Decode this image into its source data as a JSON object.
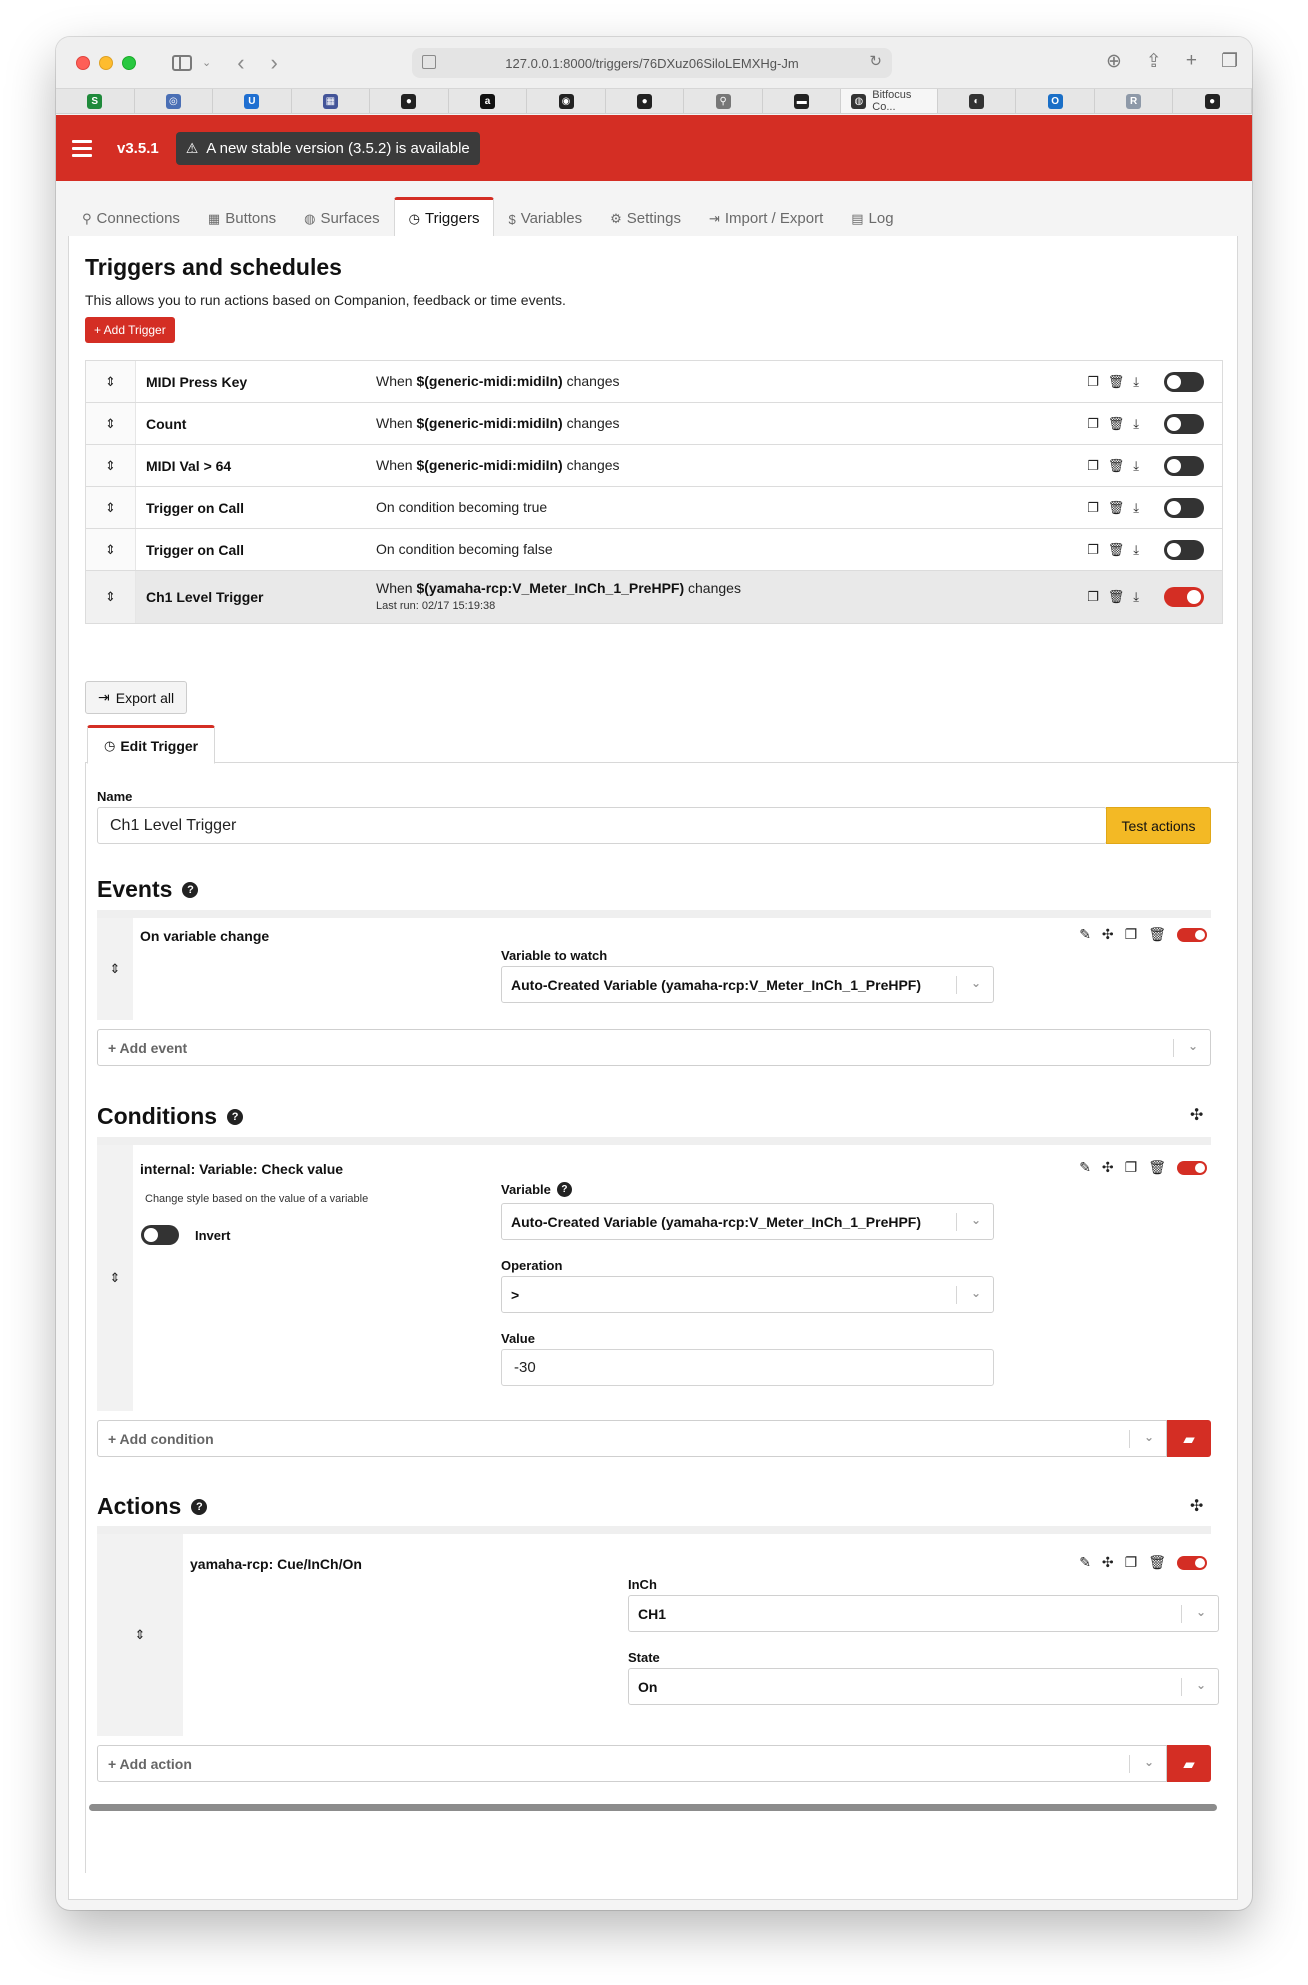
{
  "browser": {
    "url": "127.0.0.1:8000/triggers/76DXuz06SiloLEMXHg-Jm",
    "active_tab_title": "Bitfocus Co...",
    "tab_favicons": [
      {
        "icon": "s-icon",
        "color": "#1f8a3b",
        "glyph": "S"
      },
      {
        "icon": "circle-icon",
        "color": "#4a6fb5",
        "glyph": "◎"
      },
      {
        "icon": "u-icon",
        "color": "#1f6fd1",
        "glyph": "U"
      },
      {
        "icon": "image-icon",
        "color": "#445599",
        "glyph": "▦"
      },
      {
        "icon": "github-icon",
        "color": "#222222",
        "glyph": "●"
      },
      {
        "icon": "amazon-icon",
        "color": "#111111",
        "glyph": "a"
      },
      {
        "icon": "target-icon",
        "color": "#222222",
        "glyph": "◉"
      },
      {
        "icon": "github-icon",
        "color": "#222222",
        "glyph": "●"
      },
      {
        "icon": "wifi-icon",
        "color": "#777777",
        "glyph": "⚲"
      },
      {
        "icon": "terminal-icon",
        "color": "#222222",
        "glyph": "▬"
      },
      {
        "icon": "bitfocus-icon",
        "color": "#333333",
        "glyph": "◍"
      },
      {
        "icon": "globe-icon",
        "color": "#333333",
        "glyph": "◐"
      },
      {
        "icon": "outlook-icon",
        "color": "#1a6fc7",
        "glyph": "O"
      },
      {
        "icon": "r-icon",
        "color": "#8e99a8",
        "glyph": "R"
      },
      {
        "icon": "github-icon",
        "color": "#222222",
        "glyph": "●"
      }
    ]
  },
  "header": {
    "version": "v3.5.1",
    "update_notice": "A new stable version (3.5.2) is available"
  },
  "nav": {
    "tabs": [
      {
        "label": "Connections",
        "icon": "plug-icon",
        "glyph": "⚲"
      },
      {
        "label": "Buttons",
        "icon": "grid-icon",
        "glyph": "▦"
      },
      {
        "label": "Surfaces",
        "icon": "gamepad-icon",
        "glyph": "◍"
      },
      {
        "label": "Triggers",
        "icon": "clock-icon",
        "glyph": "◷"
      },
      {
        "label": "Variables",
        "icon": "dollar-icon",
        "glyph": "$"
      },
      {
        "label": "Settings",
        "icon": "gear-icon",
        "glyph": "⚙"
      },
      {
        "label": "Import / Export",
        "icon": "file-export-icon",
        "glyph": "⇥"
      },
      {
        "label": "Log",
        "icon": "clipboard-icon",
        "glyph": "▤"
      }
    ],
    "active": "Triggers"
  },
  "page": {
    "title": "Triggers and schedules",
    "description": "This allows you to run actions based on Companion, feedback or time events.",
    "add_trigger_label": "+ Add Trigger",
    "export_all_label": "Export all"
  },
  "triggers": [
    {
      "name": "MIDI Press Key",
      "prefix": "When ",
      "variable": "$(generic-midi:midiIn)",
      "suffix": " changes",
      "enabled": false
    },
    {
      "name": "Count",
      "prefix": "When ",
      "variable": "$(generic-midi:midiIn)",
      "suffix": " changes",
      "enabled": false
    },
    {
      "name": "MIDI Val > 64",
      "prefix": "When ",
      "variable": "$(generic-midi:midiIn)",
      "suffix": " changes",
      "enabled": false
    },
    {
      "name": "Trigger on Call",
      "prefix": "On condition becoming true",
      "variable": "",
      "suffix": "",
      "enabled": false
    },
    {
      "name": "Trigger on Call",
      "prefix": "On condition becoming false",
      "variable": "",
      "suffix": "",
      "enabled": false
    },
    {
      "name": "Ch1 Level Trigger",
      "prefix": "When ",
      "variable": "$(yamaha-rcp:V_Meter_InCh_1_PreHPF)",
      "suffix": " changes",
      "last_run": "Last run: 02/17 15:19:38",
      "enabled": true
    }
  ],
  "edit": {
    "tab_label": "Edit Trigger",
    "name_label": "Name",
    "name_value": "Ch1 Level Trigger",
    "test_actions_label": "Test actions",
    "events": {
      "title": "Events",
      "item_title": "On variable change",
      "field_label": "Variable to watch",
      "field_value": "Auto-Created Variable (yamaha-rcp:V_Meter_InCh_1_PreHPF)",
      "add_placeholder": "+ Add event"
    },
    "conditions": {
      "title": "Conditions",
      "item_title": "internal: Variable: Check value",
      "item_desc": "Change style based on the value of a variable",
      "invert_label": "Invert",
      "variable_label": "Variable",
      "variable_value": "Auto-Created Variable (yamaha-rcp:V_Meter_InCh_1_PreHPF)",
      "operation_label": "Operation",
      "operation_value": ">",
      "value_label": "Value",
      "value_value": "-30",
      "add_placeholder": "+ Add condition"
    },
    "actions": {
      "title": "Actions",
      "item_title": "yamaha-rcp: Cue/InCh/On",
      "inch_label": "InCh",
      "inch_value": "CH1",
      "state_label": "State",
      "state_value": "On",
      "add_placeholder": "+ Add action"
    }
  },
  "colors": {
    "brand_red": "#d42e24",
    "warning_yellow": "#f3b925",
    "badge_dark": "#3b3b3b"
  }
}
